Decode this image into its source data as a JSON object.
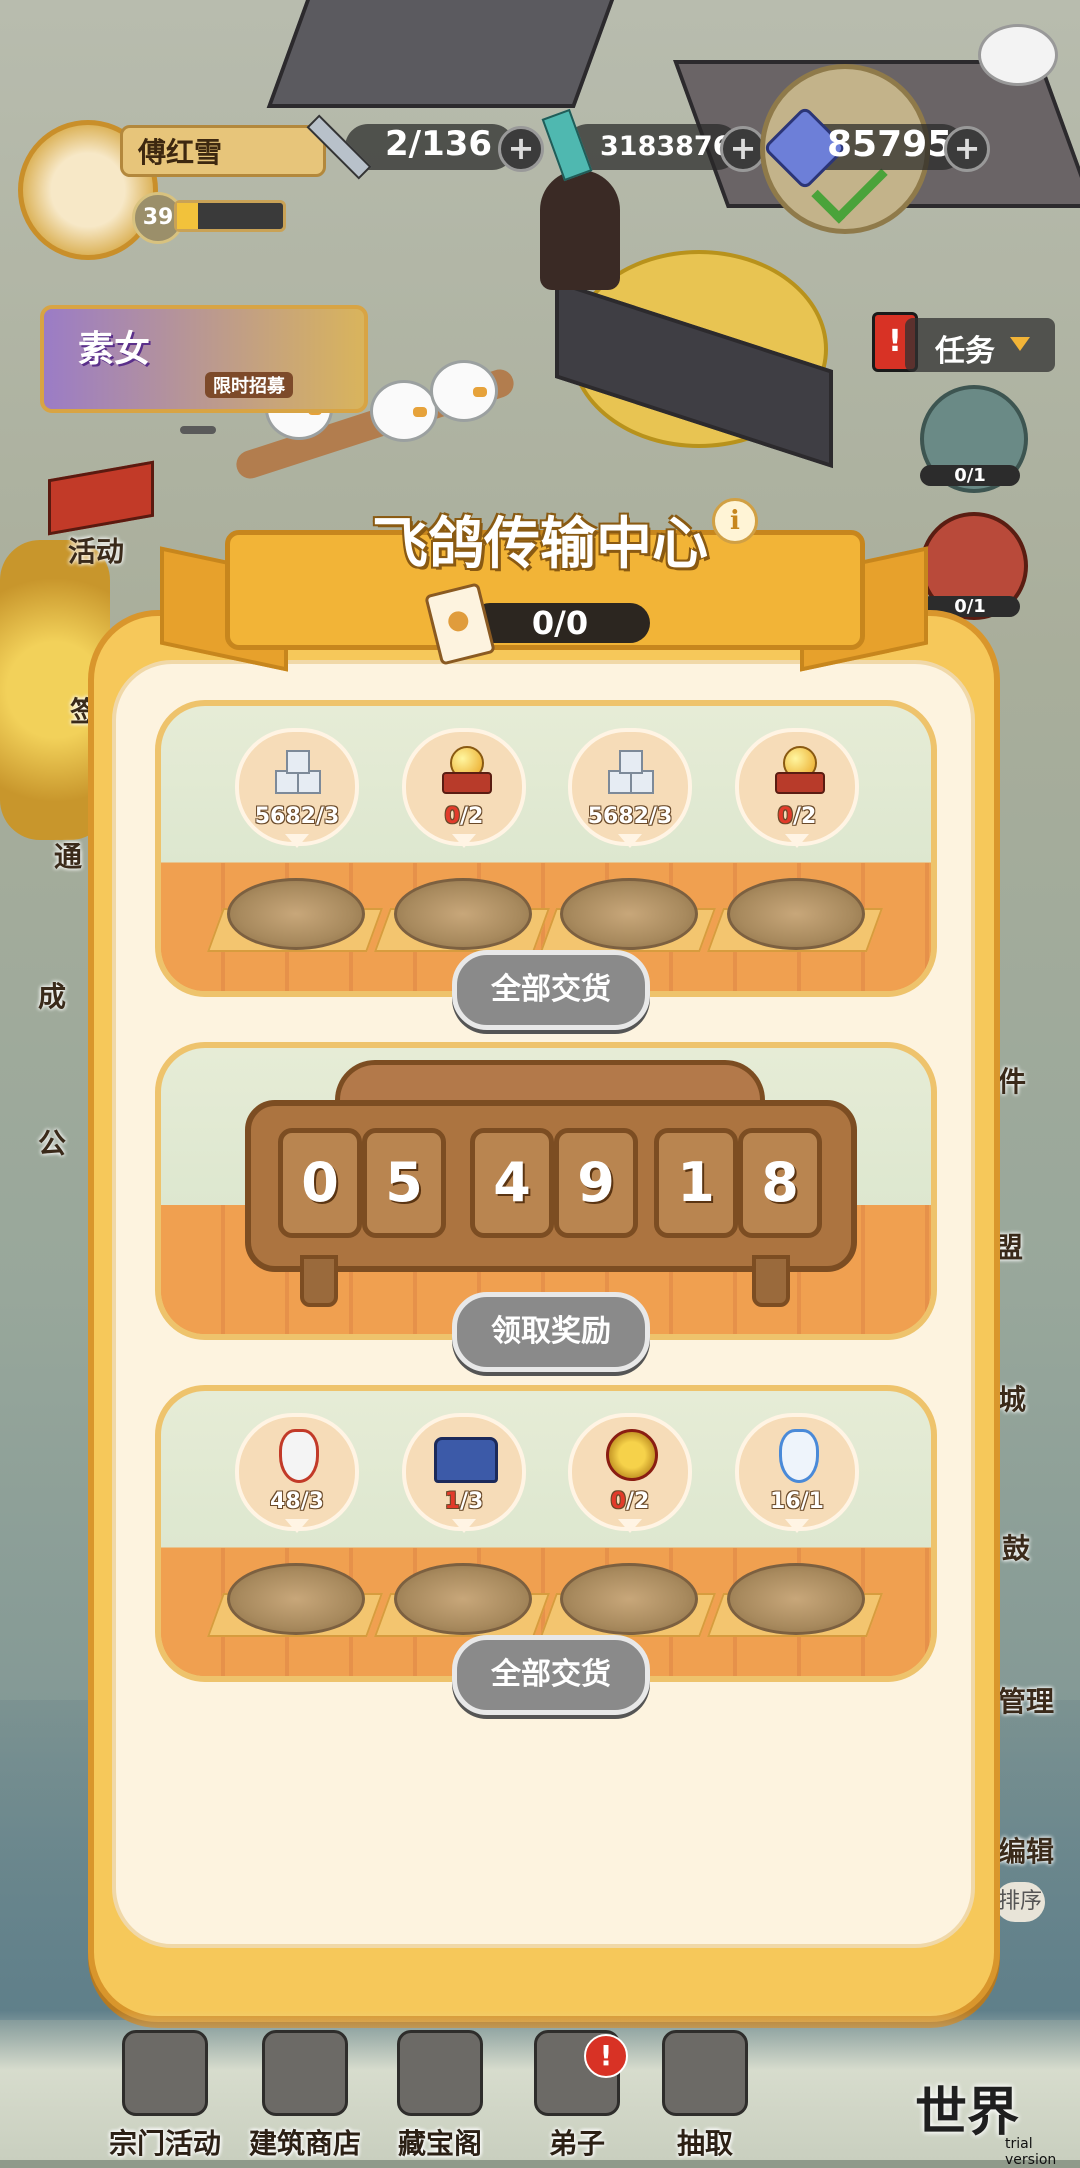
{
  "hud": {
    "player_name": "傅红雪",
    "player_level": "39",
    "stamina": "2/136",
    "jade": "3183876",
    "gems": "85795"
  },
  "left_menu": {
    "banner_name": "素女",
    "banner_tag": "限时招募",
    "activity_label": "活动",
    "label_2": "通",
    "label_3": "成",
    "label_4": "公",
    "label_5": "签"
  },
  "right_menu": {
    "task_label": "任务",
    "task_progress_1": "0/1",
    "task_progress_2": "0/1",
    "label_a": "件",
    "label_b": "盟",
    "label_c": "城",
    "label_d": "鼓",
    "label_e": "管理",
    "label_f": "编辑",
    "label_g": "排序"
  },
  "panel": {
    "title": "飞鸽传输中心",
    "info_icon": "i",
    "letters_counter": "0/0",
    "section1": {
      "items": [
        {
          "icon": "ice-blocks-icon",
          "have": "5682",
          "need": "/3",
          "enough": true
        },
        {
          "icon": "golden-orb-icon",
          "have": "0",
          "need": "/2",
          "enough": false
        },
        {
          "icon": "ice-blocks-icon",
          "have": "5682",
          "need": "/3",
          "enough": true
        },
        {
          "icon": "golden-orb-icon",
          "have": "0",
          "need": "/2",
          "enough": false
        }
      ],
      "button": "全部交货"
    },
    "section2": {
      "timer_digits": [
        "0",
        "5",
        "4",
        "9",
        "1",
        "8"
      ],
      "button": "领取奖励"
    },
    "section3": {
      "items": [
        {
          "icon": "red-gourd-icon",
          "have": "48",
          "need": "/3",
          "enough": true
        },
        {
          "icon": "treasure-chest-icon",
          "have": "1",
          "need": "/3",
          "enough": false
        },
        {
          "icon": "golden-medallion-icon",
          "have": "0",
          "need": "/2",
          "enough": false
        },
        {
          "icon": "blue-gourd-icon",
          "have": "16",
          "need": "/1",
          "enough": true
        }
      ],
      "button": "全部交货"
    }
  },
  "bottom_nav": {
    "items": [
      "宗门活动",
      "建筑商店",
      "藏宝阁",
      "弟子",
      "抽取"
    ],
    "alert": "!",
    "world": "世界"
  },
  "watermark": "trial version",
  "colors": {
    "panel_gold": "#f6c85a",
    "panel_border": "#d9962c",
    "deficit_red": "#e23b2a",
    "button_grey": "#8a8a8a"
  }
}
